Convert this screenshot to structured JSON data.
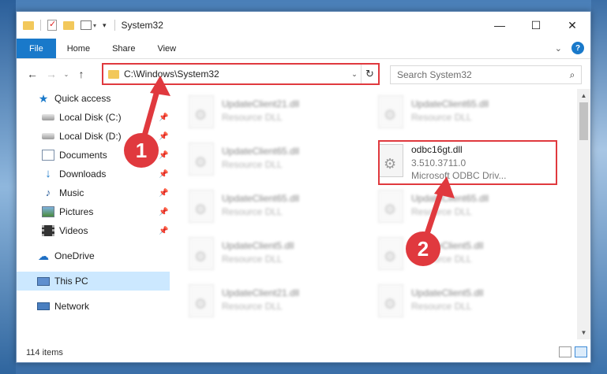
{
  "window": {
    "title": "System32",
    "controls": {
      "minimize": "—",
      "maximize": "☐",
      "close": "✕"
    }
  },
  "ribbon": {
    "tabs": [
      "File",
      "Home",
      "Share",
      "View"
    ],
    "expand_glyph": "⌄",
    "help_glyph": "?"
  },
  "navigation": {
    "back": "←",
    "forward": "→",
    "recent": "⌄",
    "up": "↑",
    "address": "C:\\Windows\\System32",
    "address_dropdown": "⌄",
    "refresh": "↻",
    "search_placeholder": "Search System32",
    "search_icon": "⌕"
  },
  "sidebar": {
    "items": [
      {
        "label": "Quick access",
        "icon": "star-icon",
        "level": 0,
        "pinned": false
      },
      {
        "label": "Local Disk (C:)",
        "icon": "disk-icon",
        "level": 1,
        "pinned": true
      },
      {
        "label": "Local Disk (D:)",
        "icon": "disk-icon",
        "level": 1,
        "pinned": true
      },
      {
        "label": "Documents",
        "icon": "documents-icon",
        "level": 1,
        "pinned": true
      },
      {
        "label": "Downloads",
        "icon": "downloads-icon",
        "level": 1,
        "pinned": true
      },
      {
        "label": "Music",
        "icon": "music-icon",
        "level": 1,
        "pinned": true
      },
      {
        "label": "Pictures",
        "icon": "pictures-icon",
        "level": 1,
        "pinned": true
      },
      {
        "label": "Videos",
        "icon": "videos-icon",
        "level": 1,
        "pinned": true
      },
      {
        "label": "OneDrive",
        "icon": "onedrive-icon",
        "level": 0,
        "pinned": false
      },
      {
        "label": "This PC",
        "icon": "this-pc-icon",
        "level": 0,
        "pinned": false,
        "selected": true
      },
      {
        "label": "Network",
        "icon": "network-icon",
        "level": 0,
        "pinned": false
      }
    ]
  },
  "files": {
    "left_column": [
      {
        "name": "UpdateClient21.dll",
        "desc": "Resource DLL"
      },
      {
        "name": "UpdateClient65.dll",
        "desc": "Resource DLL"
      },
      {
        "name": "UpdateClient65.dll",
        "desc": "Resource DLL"
      },
      {
        "name": "UpdateClient5.dll",
        "desc": "Resource DLL"
      },
      {
        "name": "UpdateClient21.dll",
        "desc": "Resource DLL"
      }
    ],
    "right_column": [
      {
        "name": "UpdateClient65.dll",
        "desc": "Resource DLL"
      },
      {
        "name": "odbc16gt.dll",
        "desc": "3.510.3711.0",
        "desc2": "Microsoft ODBC Driv...",
        "highlighted": true
      },
      {
        "name": "UpdateClient65.dll",
        "desc": "Resource DLL"
      },
      {
        "name": "UpdateClient5.dll",
        "desc": "Resource DLL"
      },
      {
        "name": "UpdateClient5.dll",
        "desc": "Resource DLL"
      }
    ]
  },
  "status": {
    "item_count": "114 items"
  },
  "annotations": {
    "badge1": "1",
    "badge2": "2",
    "accent_color": "#e0393e"
  }
}
